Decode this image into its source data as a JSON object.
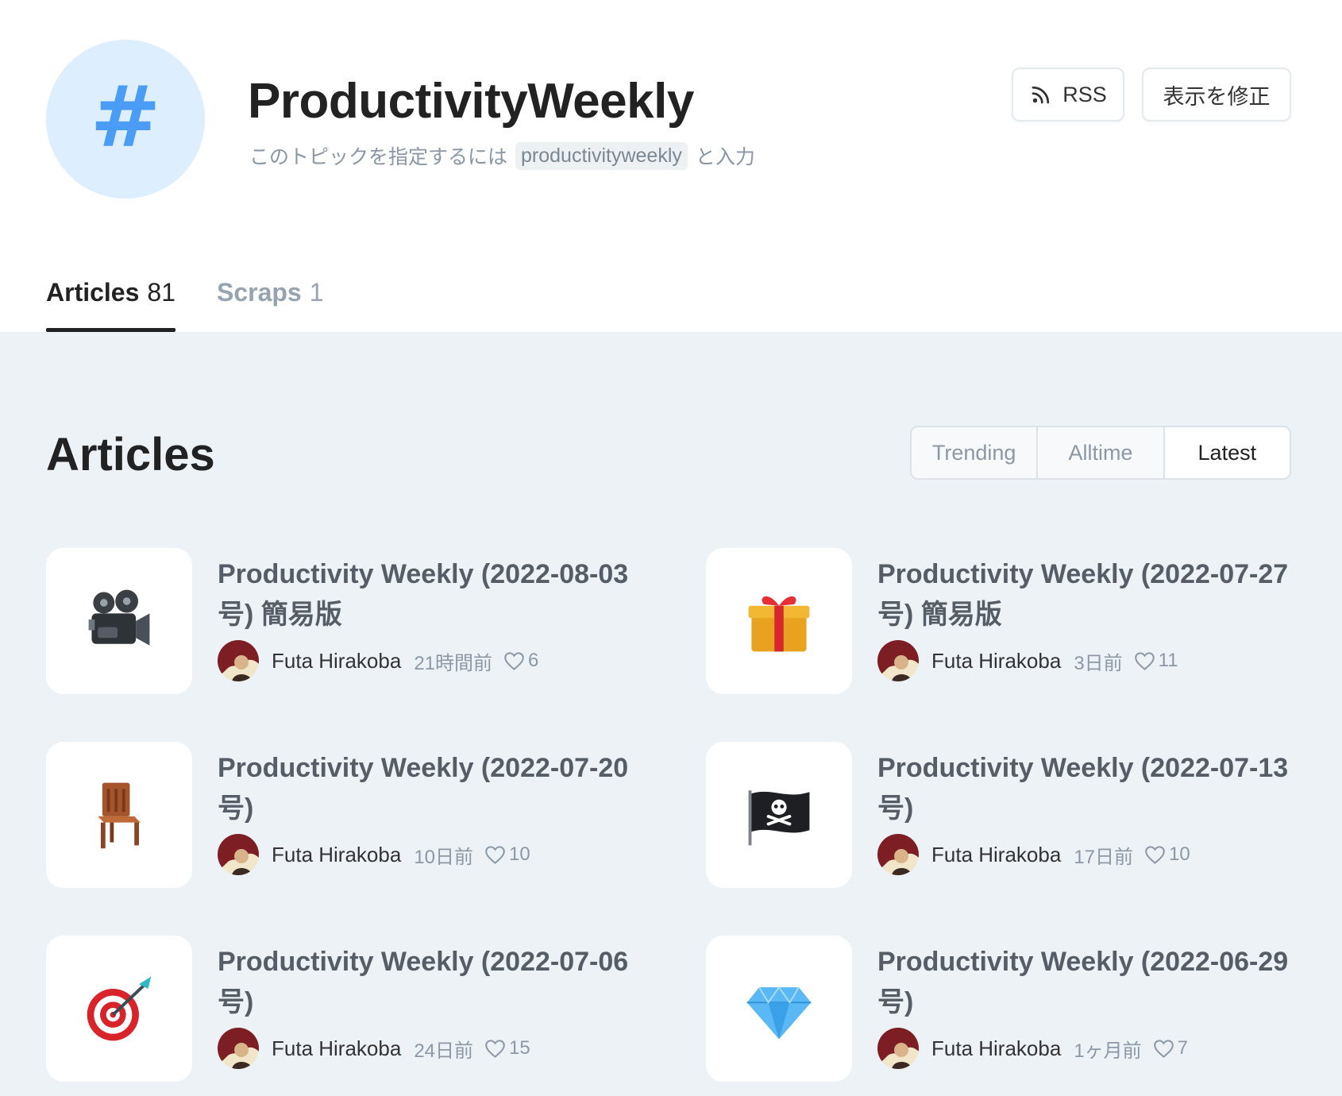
{
  "header": {
    "icon": "hash-icon",
    "title": "ProductivityWeekly",
    "hint_prefix": "このトピックを指定するには",
    "hint_code": "productivityweekly",
    "hint_suffix": "と入力",
    "rss_label": "RSS",
    "edit_label": "表示を修正"
  },
  "tabs": [
    {
      "label": "Articles",
      "count": "81"
    },
    {
      "label": "Scraps",
      "count": "1"
    }
  ],
  "section": {
    "title": "Articles",
    "sort_options": [
      "Trending",
      "Alltime",
      "Latest"
    ],
    "active_sort": "Latest"
  },
  "articles": [
    {
      "title": "Productivity Weekly (2022-08-03号) 簡易版",
      "icon": "movie-camera-icon",
      "author": "Futa Hirakoba",
      "time": "21時間前",
      "likes": "6"
    },
    {
      "title": "Productivity Weekly (2022-07-27号) 簡易版",
      "icon": "gift-icon",
      "author": "Futa Hirakoba",
      "time": "3日前",
      "likes": "11"
    },
    {
      "title": "Productivity Weekly (2022-07-20号)",
      "icon": "chair-icon",
      "author": "Futa Hirakoba",
      "time": "10日前",
      "likes": "10"
    },
    {
      "title": "Productivity Weekly (2022-07-13号)",
      "icon": "pirate-flag-icon",
      "author": "Futa Hirakoba",
      "time": "17日前",
      "likes": "10"
    },
    {
      "title": "Productivity Weekly (2022-07-06号)",
      "icon": "direct-hit-icon",
      "author": "Futa Hirakoba",
      "time": "24日前",
      "likes": "15"
    },
    {
      "title": "Productivity Weekly (2022-06-29号)",
      "icon": "gem-icon",
      "author": "Futa Hirakoba",
      "time": "1ヶ月前",
      "likes": "7"
    }
  ]
}
